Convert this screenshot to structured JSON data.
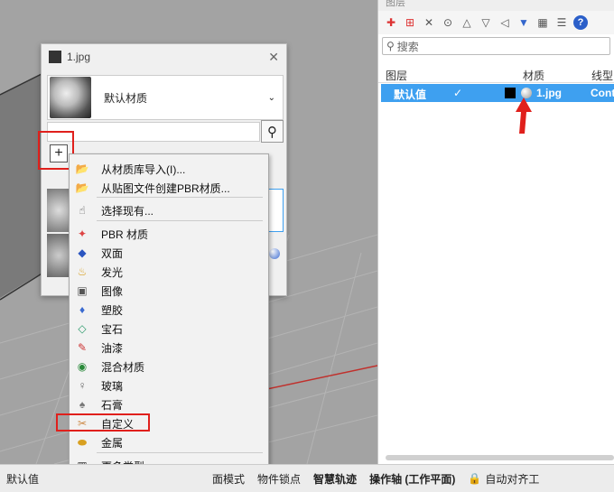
{
  "layers_panel": {
    "title": "图层",
    "search_placeholder": "搜索",
    "columns": [
      "图层",
      "材质",
      "线型"
    ],
    "row": {
      "name": "默认值",
      "check": "✓",
      "material": "1.jpg",
      "linetype": "Cont"
    }
  },
  "dialog": {
    "title": "1.jpg",
    "material_name": "默认材质",
    "plus_label": "+"
  },
  "menu": {
    "items": [
      {
        "label": "从材质库导入(I)...",
        "icon": "folder-open-icon"
      },
      {
        "label": "从贴图文件创建PBR材质...",
        "icon": "folder-image-icon"
      },
      {
        "label": "选择现有...",
        "icon": "hand-pointer-icon"
      },
      {
        "label": "PBR 材质",
        "icon": "pbr-icon"
      },
      {
        "label": "双面",
        "icon": "double-sided-icon"
      },
      {
        "label": "发光",
        "icon": "emission-icon"
      },
      {
        "label": "图像",
        "icon": "image-icon"
      },
      {
        "label": "塑胶",
        "icon": "plastic-icon"
      },
      {
        "label": "宝石",
        "icon": "gem-icon"
      },
      {
        "label": "油漆",
        "icon": "paint-icon"
      },
      {
        "label": "混合材质",
        "icon": "blend-icon"
      },
      {
        "label": "玻璃",
        "icon": "glass-icon"
      },
      {
        "label": "石膏",
        "icon": "plaster-icon"
      },
      {
        "label": "自定义",
        "icon": "custom-icon"
      },
      {
        "label": "金属",
        "icon": "metal-icon"
      },
      {
        "label": "更多类型...",
        "icon": "grid-icon"
      }
    ]
  },
  "status_bar": {
    "items": [
      "默认值",
      "面模式",
      "物件锁点",
      "智慧轨迹",
      "操作轴 (工作平面)",
      "自动对齐工"
    ]
  },
  "colors": {
    "selection": "#3ea0f0",
    "highlight_box": "#e0201c",
    "arrow": "#e0201c"
  }
}
